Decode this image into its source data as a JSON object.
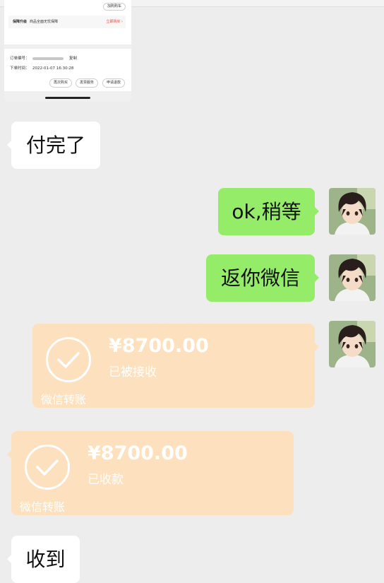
{
  "order_screenshot": {
    "cart_button": "加购购车",
    "service": {
      "name": "保障升级",
      "desc": "商品全面无忧保障",
      "link": "立即购买",
      "link_arrow": "›"
    },
    "order_no_label": "订单编号：",
    "copy_label": "复制",
    "order_time_label": "下单时间：",
    "order_time": "2022-01-07 16:30:28",
    "buttons": [
      "再次购买",
      "发票服务",
      "申请退款"
    ]
  },
  "messages": {
    "m1": "付完了",
    "m2": "ok,稍等",
    "m3": "返你微信",
    "m6": "收到"
  },
  "transfers": [
    {
      "amount": "¥8700.00",
      "status": "已被接收",
      "footer": "微信转账"
    },
    {
      "amount": "¥8700.00",
      "status": "已收款",
      "footer": "微信转账"
    }
  ],
  "colors": {
    "chat_background": "#ededed",
    "self_bubble": "#95ec69",
    "other_bubble": "#ffffff",
    "transfer_card": "#fde0bd"
  },
  "icons": {
    "transfer": "check-circle-icon",
    "avatar": "anime-avatar"
  }
}
